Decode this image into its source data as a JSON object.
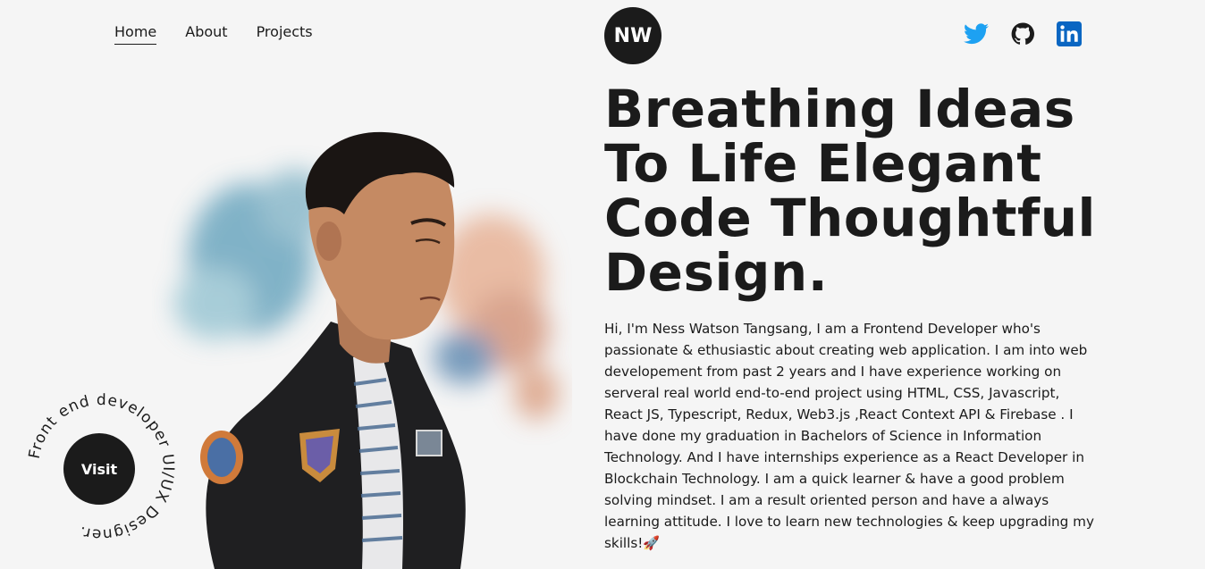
{
  "nav": {
    "items": [
      {
        "label": "Home",
        "active": true
      },
      {
        "label": "About",
        "active": false
      },
      {
        "label": "Projects",
        "active": false
      }
    ]
  },
  "logo": {
    "text": "NW"
  },
  "social": [
    {
      "icon": "twitter-icon",
      "color": "#1da1f2"
    },
    {
      "icon": "github-icon",
      "color": "#1b1b1b"
    },
    {
      "icon": "linkedin-icon",
      "color": "#0a66c2"
    }
  ],
  "hero": {
    "headline": "Breathing Ideas To Life Elegant Code Thoughtful Design.",
    "bio": "Hi, I'm Ness Watson Tangsang, I am a Frontend Developer who's passionate & ethusiastic about creating web application. I am into web developement from past 2 years and I have experience working on serveral real world end-to-end project using HTML, CSS, Javascript, React JS, Typescript, Redux, Web3.js ,React Context API & Firebase . I have done my graduation in Bachelors of Science in Information Technology. And I have internships experience as a React Developer in Blockchain Technology. I am a quick learner & have a good problem solving mindset. I am a result oriented person and have a always learning attitude. I love to learn new technologies & keep upgrading my skills!🚀"
  },
  "visit": {
    "label": "Visit",
    "ring_text": "Front end developer UI/UX Designer."
  },
  "colors": {
    "background": "#f5f5f5",
    "text": "#1b1b1b"
  }
}
